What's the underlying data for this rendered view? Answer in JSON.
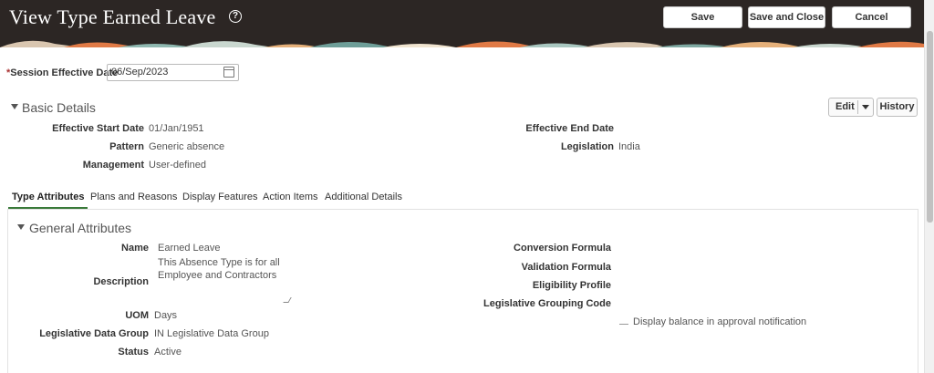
{
  "header": {
    "title": "View Type Earned Leave",
    "save_label": "Save",
    "save_close_label": "Save and Close",
    "cancel_label": "Cancel"
  },
  "session": {
    "label": "Session Effective Date",
    "required_mark": "*",
    "date_value": "06/Sep/2023"
  },
  "basic_details": {
    "title": "Basic Details",
    "edit_label": "Edit",
    "history_label": "History",
    "fields": {
      "effective_start_label": "Effective Start Date",
      "effective_start_value": "01/Jan/1951",
      "pattern_label": "Pattern",
      "pattern_value": "Generic absence",
      "management_label": "Management",
      "management_value": "User-defined",
      "effective_end_label": "Effective End Date",
      "legislation_label": "Legislation",
      "legislation_value": "India"
    }
  },
  "tabs": [
    {
      "label": "Type Attributes",
      "active": true
    },
    {
      "label": "Plans and Reasons",
      "active": false
    },
    {
      "label": "Display Features",
      "active": false
    },
    {
      "label": "Action Items",
      "active": false
    },
    {
      "label": "Additional Details",
      "active": false
    }
  ],
  "general_attributes": {
    "title": "General Attributes",
    "name_label": "Name",
    "name_value": "Earned Leave",
    "description_label": "Description",
    "description_value": "This Absence Type is for all Employee and Contractors",
    "uom_label": "UOM",
    "uom_value": "Days",
    "ldg_label": "Legislative Data Group",
    "ldg_value": "IN Legislative Data Group",
    "status_label": "Status",
    "status_value": "Active",
    "conversion_label": "Conversion Formula",
    "validation_label": "Validation Formula",
    "eligibility_label": "Eligibility Profile",
    "grouping_label": "Legislative Grouping Code",
    "display_balance_label": "Display balance in approval notification",
    "display_balance_checked": false
  }
}
